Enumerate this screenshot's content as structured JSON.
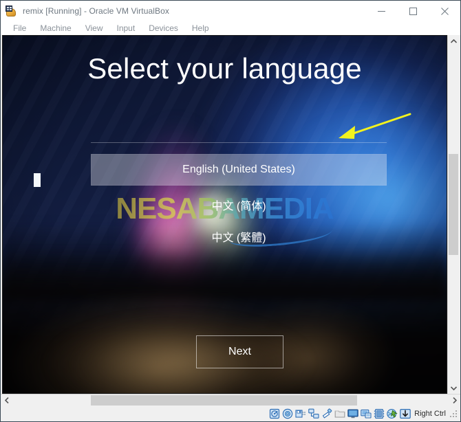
{
  "window": {
    "title": "remix [Running] - Oracle VM VirtualBox",
    "icon": "virtualbox-icon",
    "controls": [
      {
        "name": "minimize-button",
        "glyph": "minimize"
      },
      {
        "name": "maximize-button",
        "glyph": "maximize"
      },
      {
        "name": "close-button",
        "glyph": "close"
      }
    ]
  },
  "menubar": {
    "items": [
      {
        "label": "File"
      },
      {
        "label": "Machine"
      },
      {
        "label": "View"
      },
      {
        "label": "Input"
      },
      {
        "label": "Devices"
      },
      {
        "label": "Help"
      }
    ]
  },
  "guest": {
    "title": "Select your language",
    "languages": [
      {
        "label": "English (United States)",
        "selected": true
      },
      {
        "label": "中文 (简体)",
        "selected": false
      },
      {
        "label": "中文 (繁體)",
        "selected": false
      }
    ],
    "next_button": "Next",
    "annotation": {
      "type": "arrow",
      "color": "#f2f21e",
      "points_to": "English (United States)"
    },
    "watermark": "NESABAMEDIA",
    "colors": {
      "aurora_pink": "#ee78be",
      "aurora_blue": "#3a82e2",
      "aurora_green": "#e6f0c8",
      "ground_warm": "#be9660",
      "text": "#ffffff"
    }
  },
  "scrollbars": {
    "vertical": {
      "up": "▲",
      "down": "▼"
    },
    "horizontal": {
      "left": "❮",
      "right": "❯"
    }
  },
  "statusbar": {
    "icons": [
      {
        "name": "hard-disk-icon",
        "title": "Hard Disks"
      },
      {
        "name": "optical-drive-icon",
        "title": "Optical Drives"
      },
      {
        "name": "floppy-drive-icon",
        "title": "Floppy Drives"
      },
      {
        "name": "network-icon",
        "title": "Network"
      },
      {
        "name": "usb-icon",
        "title": "USB Devices"
      },
      {
        "name": "shared-folders-icon",
        "title": "Shared Folders"
      },
      {
        "name": "display-icon",
        "title": "Display"
      },
      {
        "name": "recording-icon",
        "title": "Recording"
      },
      {
        "name": "cpu-icon",
        "title": "Features"
      },
      {
        "name": "mouse-integration-icon",
        "title": "Mouse Integration"
      },
      {
        "name": "keyboard-icon",
        "title": "Keyboard"
      }
    ],
    "host_key": "Right Ctrl"
  }
}
